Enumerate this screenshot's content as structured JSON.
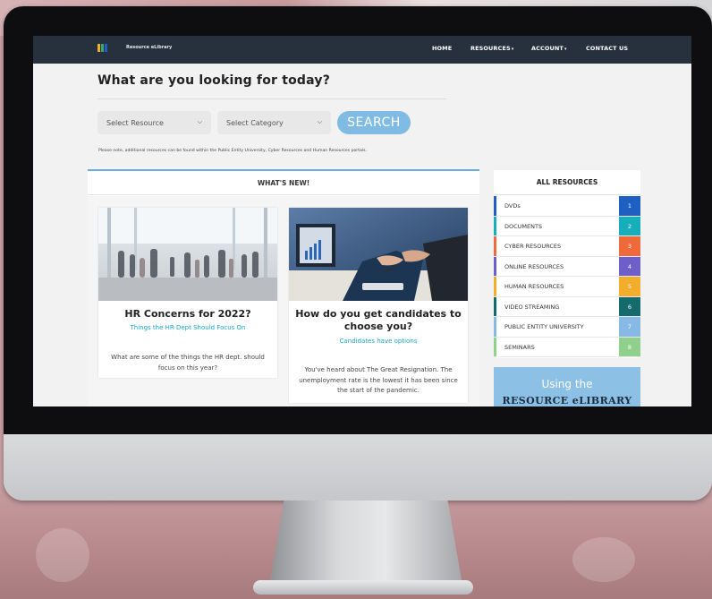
{
  "navbar": {
    "brand": "Resource eLibrary",
    "items": [
      {
        "label": "HOME"
      },
      {
        "label": "RESOURCES"
      },
      {
        "label": "ACCOUNT"
      },
      {
        "label": "CONTACT US"
      }
    ]
  },
  "search": {
    "headline": "What are you looking for today?",
    "resource_select": "Select Resource",
    "category_select": "Select Category",
    "button": "SEARCH",
    "note": "Please note, additional resources can be found within the Public Entity University, Cyber Resources and Human Resources portals."
  },
  "whats_new": {
    "heading": "WHAT'S NEW!",
    "cards": [
      {
        "title": "HR Concerns for 2022?",
        "subtitle": "Things the HR Dept Should Focus On",
        "text": "What are some of the things the HR dept. should focus on this year?"
      },
      {
        "title": "How do you get candidates to choose you?",
        "subtitle": "Candidates have options",
        "text": "You've heard about The Great Resignation. The unemployment rate is the lowest it has been since the start of the pandemic."
      }
    ]
  },
  "resources": {
    "heading": "ALL RESOURCES",
    "items": [
      {
        "label": "DVDs",
        "count": "1",
        "color": "#1f5fc4"
      },
      {
        "label": "DOCUMENTS",
        "count": "2",
        "color": "#17aebc"
      },
      {
        "label": "CYBER RESOURCES",
        "count": "3",
        "color": "#ef6a3a"
      },
      {
        "label": "ONLINE RESOURCES",
        "count": "4",
        "color": "#6d5ec9"
      },
      {
        "label": "HUMAN RESOURCES",
        "count": "5",
        "color": "#f2ad2c"
      },
      {
        "label": "VIDEO STREAMING",
        "count": "6",
        "color": "#156a6c"
      },
      {
        "label": "PUBLIC ENTITY UNIVERSITY",
        "count": "7",
        "color": "#88b8e4"
      },
      {
        "label": "SEMINARS",
        "count": "8",
        "color": "#8fd18c"
      }
    ]
  },
  "promo": {
    "line1": "Using the",
    "line2": "RESOURCE eLIBRARY"
  },
  "colors": {
    "navbar": "#27303d",
    "accent": "#7fbbe3",
    "link": "#19a6c7"
  }
}
